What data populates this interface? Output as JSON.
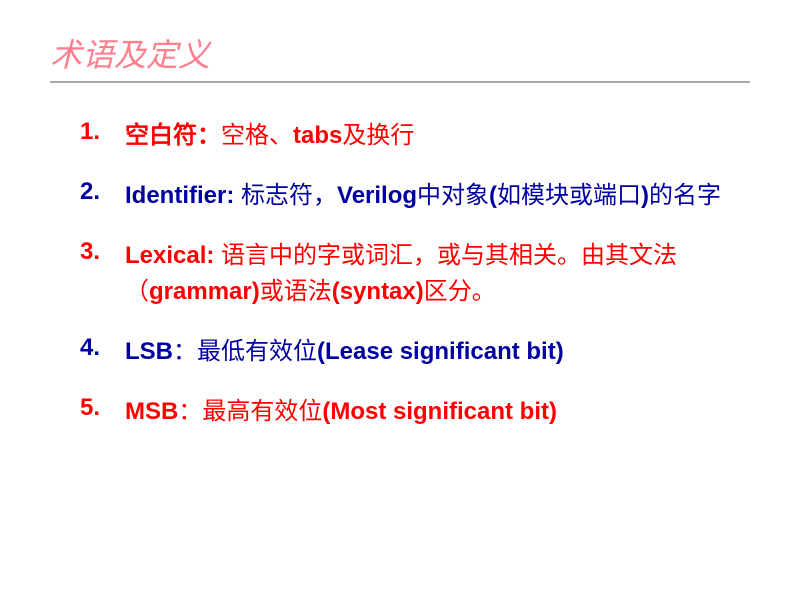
{
  "title": "术语及定义",
  "items": [
    {
      "number": "1.",
      "label_pre": "空白符：",
      "label_post": "空格、",
      "bold_mid": "tabs",
      "after": "及换行",
      "color": "red"
    },
    {
      "number": "2.",
      "bold_pre": "Identifier: ",
      "plain_mid": "标志符，",
      "bold_mid": "Verilog",
      "plain_mid2": "中对象",
      "bold_end": "(",
      "plain_end": "如模块或端口",
      "bold_close": ")",
      "after": "的名字",
      "color": "blue"
    },
    {
      "number": "3.",
      "bold_pre": "Lexical: ",
      "plain": "语言中的字或词汇，或与其相关。由其文法（",
      "bold_mid": "grammar)",
      "plain_mid2": "或语法",
      "bold_end": "(syntax)",
      "after": "区分。",
      "color": "red"
    },
    {
      "number": "4.",
      "bold_pre": "LSB",
      "plain": "：最低有效位",
      "bold_end": "(Lease significant bit)",
      "color": "blue"
    },
    {
      "number": "5.",
      "bold_pre": "MSB",
      "plain": "：最高有效位",
      "bold_end": "(Most significant bit)",
      "color": "red"
    }
  ]
}
